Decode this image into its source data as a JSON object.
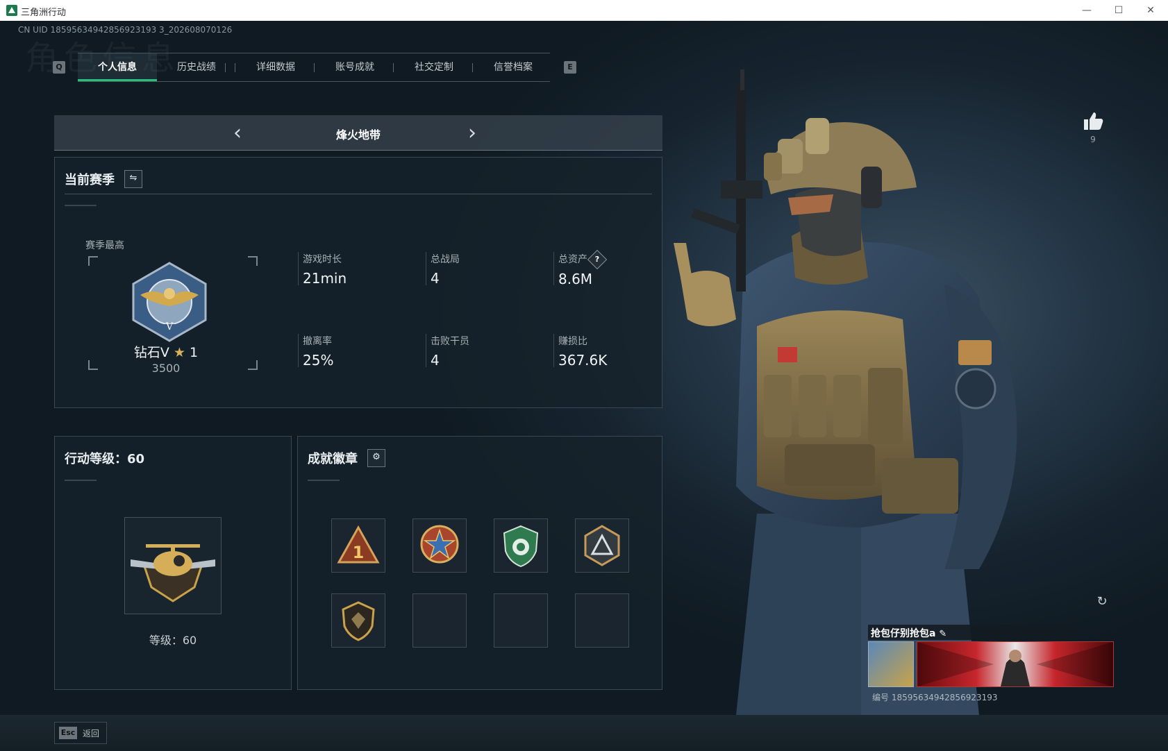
{
  "window": {
    "title": "三角洲行动",
    "minimize": "—",
    "maximize": "☐",
    "close": "✕"
  },
  "header": {
    "background_text": "角色信息",
    "uid": "CN UID 18595634942856923193 3_202608070126"
  },
  "tabs": {
    "prev_key": "Q",
    "next_key": "E",
    "items": [
      {
        "label": "个人信息",
        "active": true
      },
      {
        "label": "历史战绩",
        "active": false
      },
      {
        "label": "详细数据",
        "active": false
      },
      {
        "label": "账号成就",
        "active": false
      },
      {
        "label": "社交定制",
        "active": false
      },
      {
        "label": "信誉档案",
        "active": false
      }
    ]
  },
  "mode": {
    "name": "烽火地带",
    "prev_glyph": "‹",
    "next_glyph": "›"
  },
  "season": {
    "title": "当前赛季",
    "switch_glyph": "⇋",
    "best_label": "赛季最高",
    "rank_name": "钻石V",
    "rank_star": "★",
    "rank_stars": "1",
    "rank_score": "3500",
    "stats": [
      {
        "label": "游戏时长",
        "value": "21min"
      },
      {
        "label": "总战局",
        "value": "4"
      },
      {
        "label": "总资产",
        "value": "8.6M",
        "help": "?"
      },
      {
        "label": "撤离率",
        "value": "25%"
      },
      {
        "label": "击败干员",
        "value": "4"
      },
      {
        "label": "赚损比",
        "value": "367.6K"
      }
    ]
  },
  "level": {
    "title": "行动等级：60",
    "label": "等级：60"
  },
  "badges": {
    "title": "成就徽章",
    "settings_glyph": "⚙",
    "slots": [
      {
        "icon": "triangle-rank-badge-icon",
        "filled": true
      },
      {
        "icon": "star-emblem-badge-icon",
        "filled": true
      },
      {
        "icon": "green-shield-badge-icon",
        "filled": true
      },
      {
        "icon": "hexagon-delta-badge-icon",
        "filled": true
      },
      {
        "icon": "dark-shield-badge-icon",
        "filled": true
      },
      {
        "icon": "",
        "filled": false
      },
      {
        "icon": "",
        "filled": false
      },
      {
        "icon": "",
        "filled": false
      }
    ]
  },
  "likes": {
    "count": "9"
  },
  "player_card": {
    "name": "抢包仔别抢包a",
    "edit_glyph": "✎",
    "id_text": "编号 18595634942856923193",
    "refresh_glyph": "↻"
  },
  "footer": {
    "esc_key": "Esc",
    "esc_label": "返回"
  },
  "colors": {
    "accent": "#27c07a",
    "panel_bg": "#16222b",
    "gold": "#c9a34a"
  }
}
